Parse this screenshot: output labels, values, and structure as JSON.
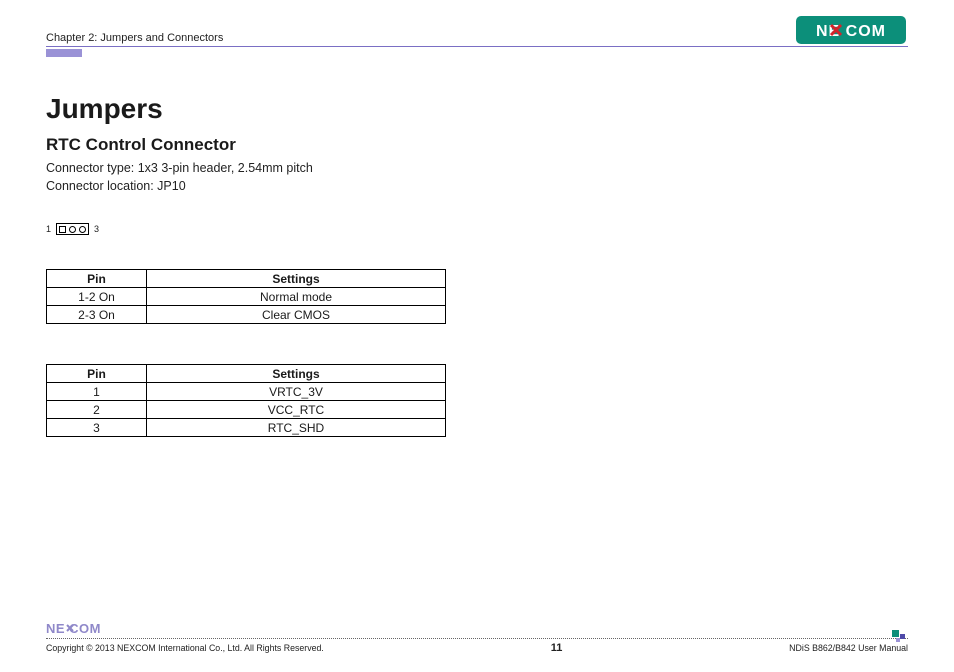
{
  "header": {
    "chapter": "Chapter 2: Jumpers and Connectors"
  },
  "title": "Jumpers",
  "subtitle": "RTC Control Connector",
  "body_line1": "Connector type: 1x3 3-pin header, 2.54mm pitch",
  "body_line2": "Connector location: JP10",
  "pin_diagram": {
    "left": "1",
    "right": "3"
  },
  "table1": {
    "headers": {
      "pin": "Pin",
      "settings": "Settings"
    },
    "rows": [
      {
        "pin": "1-2 On",
        "settings": "Normal mode"
      },
      {
        "pin": "2-3 On",
        "settings": "Clear CMOS"
      }
    ]
  },
  "table2": {
    "headers": {
      "pin": "Pin",
      "settings": "Settings"
    },
    "rows": [
      {
        "pin": "1",
        "settings": "VRTC_3V"
      },
      {
        "pin": "2",
        "settings": "VCC_RTC"
      },
      {
        "pin": "3",
        "settings": "RTC_SHD"
      }
    ]
  },
  "footer": {
    "copyright": "Copyright © 2013 NEXCOM International Co., Ltd. All Rights Reserved.",
    "page": "11",
    "manual": "NDiS B862/B842 User Manual"
  }
}
